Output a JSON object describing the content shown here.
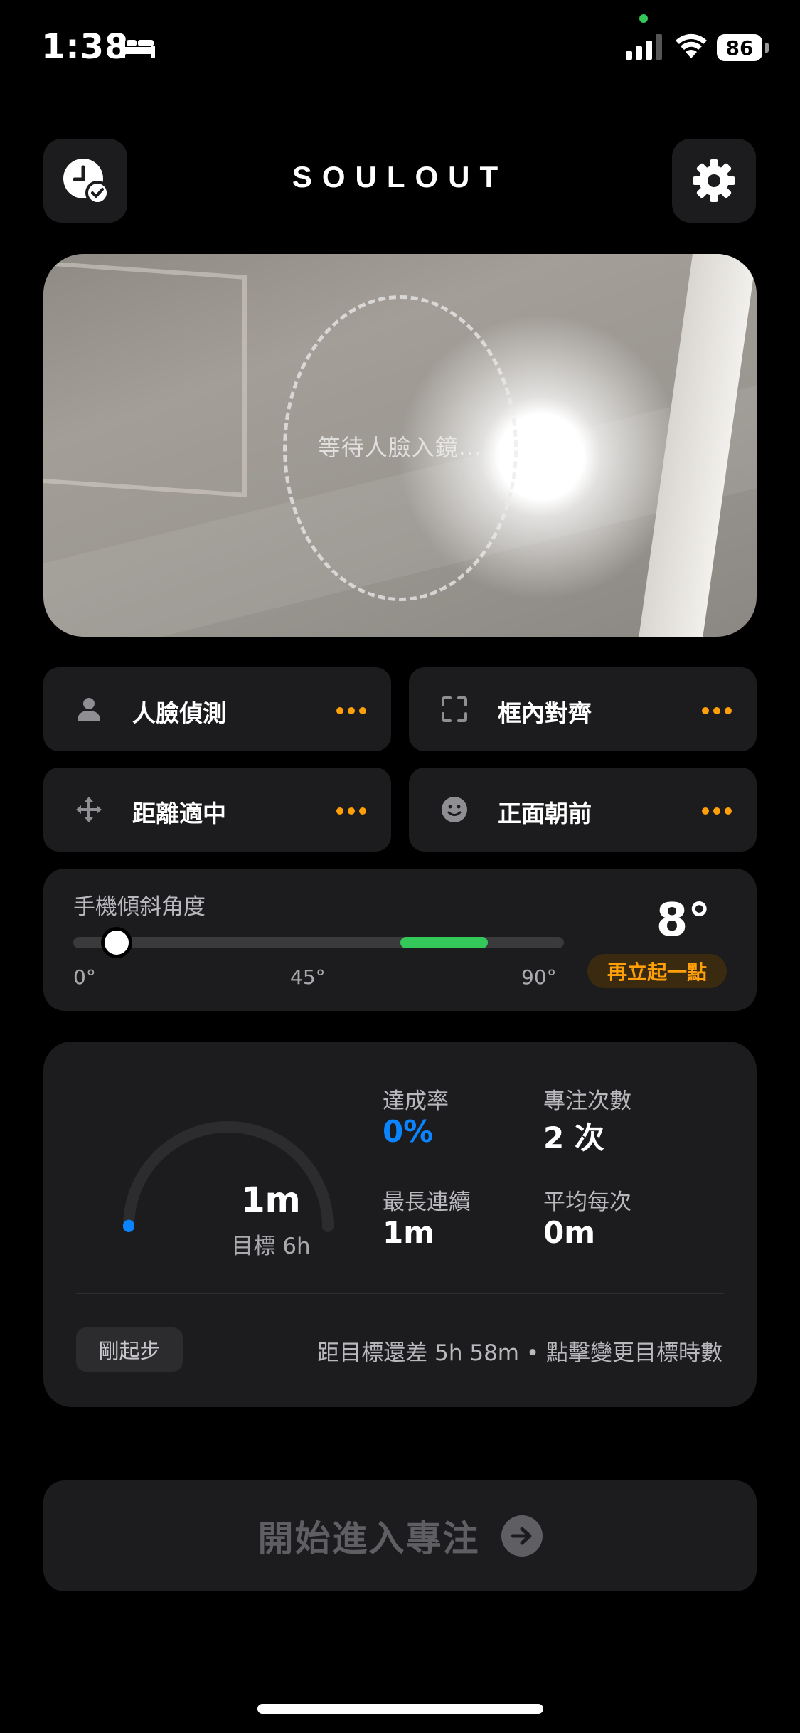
{
  "status_bar": {
    "time": "1:38",
    "battery": "86"
  },
  "header": {
    "title": "SOULOUT"
  },
  "camera": {
    "waiting_text": "等待人臉入鏡..."
  },
  "checks": [
    {
      "label": "人臉偵測",
      "icon": "person-icon"
    },
    {
      "label": "框內對齊",
      "icon": "frame-icon"
    },
    {
      "label": "距離適中",
      "icon": "move-arrows-icon"
    },
    {
      "label": "正面朝前",
      "icon": "smiley-icon"
    }
  ],
  "tilt": {
    "label": "手機傾斜角度",
    "ticks": [
      "0°",
      "45°",
      "90°"
    ],
    "value": "8°",
    "value_deg": 8,
    "target_range_deg": [
      60,
      76
    ],
    "hint": "再立起一點"
  },
  "stats": {
    "gauge_value": "1m",
    "gauge_target": "目標 6h",
    "gauge_progress": 0.003,
    "completion_label": "達成率",
    "completion_value": "0%",
    "sessions_label": "專注次數",
    "sessions_value": "2 次",
    "longest_label": "最長連續",
    "longest_value": "1m",
    "average_label": "平均每次",
    "average_value": "0m",
    "level_badge": "剛起步",
    "remaining_text": "距目標還差 5h 58m • 點擊變更目標時數"
  },
  "start_button": {
    "label": "開始進入專注"
  },
  "colors": {
    "accent": "#0a84ff",
    "warning": "#ff9f0a",
    "success": "#34c759",
    "card": "#1c1c1e"
  }
}
